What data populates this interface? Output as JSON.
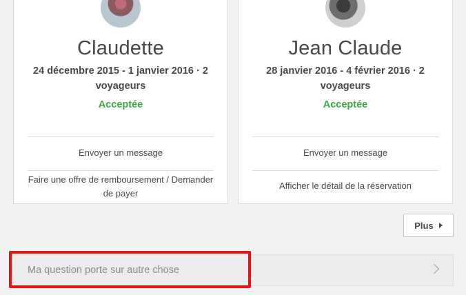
{
  "reservations": [
    {
      "guest_name": "Claudette",
      "dates": "24 décembre 2015 - 1 janvier 2016 · 2 voyageurs",
      "status": "Acceptée",
      "action1": "Envoyer un message",
      "action2": "Faire une offre de remboursement / Demander de payer"
    },
    {
      "guest_name": "Jean Claude",
      "dates": "28 janvier 2016 - 4 février 2016 · 2 voyageurs",
      "status": "Acceptée",
      "action1": "Envoyer un message",
      "action2": "Afficher le détail de la réservation"
    }
  ],
  "more_button": {
    "label": "Plus"
  },
  "other_question": {
    "label": "Ma question porte sur autre chose"
  },
  "colors": {
    "status_accepted": "#3ea844",
    "highlight": "#e8141a"
  }
}
